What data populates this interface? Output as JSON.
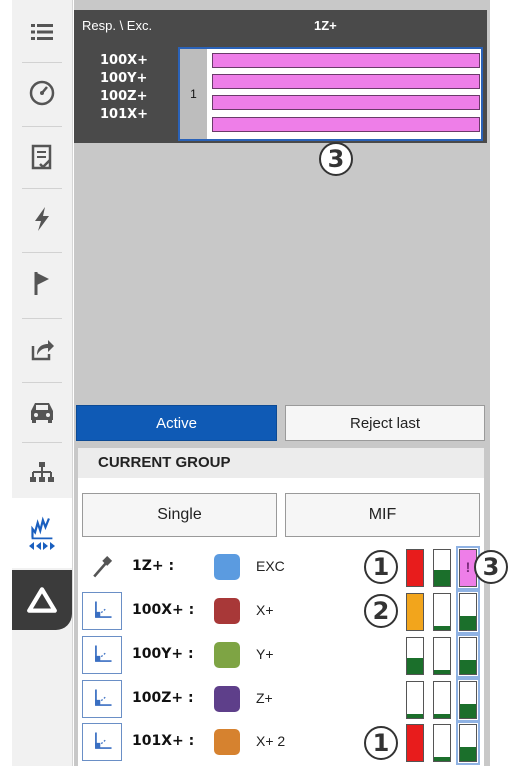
{
  "matrix": {
    "header_resp_exc": "Resp. \\ Exc.",
    "header_excitation": "1Z+",
    "rows": [
      "100X+",
      "100Y+",
      "100Z+",
      "101X+"
    ],
    "group_number": "1"
  },
  "buttons": {
    "active": "Active",
    "reject_last": "Reject last",
    "single": "Single",
    "mif": "MIF"
  },
  "current_group": {
    "title": "CURRENT GROUP"
  },
  "channels": [
    {
      "name": "1Z+ :",
      "color": "#5b9be0",
      "direction": "EXC",
      "icon": "hammer-icon",
      "meters": [
        {
          "level": 1.0,
          "color": "#e81c1c"
        },
        {
          "level": 0.45,
          "color": "#1b6f2b"
        },
        {
          "level": 1.0,
          "color": "#ee7ee8",
          "mark": "!"
        }
      ]
    },
    {
      "name": "100X+ :",
      "color": "#a83838",
      "direction": "X+",
      "icon": "accelerometer-icon",
      "meters": [
        {
          "level": 1.0,
          "color": "#f2a51c"
        },
        {
          "level": 0.1,
          "color": "#1b6f2b"
        },
        {
          "level": 0.4,
          "color": "#1b6f2b"
        }
      ]
    },
    {
      "name": "100Y+ :",
      "color": "#7ea444",
      "direction": "Y+",
      "icon": "accelerometer-icon",
      "meters": [
        {
          "level": 0.45,
          "color": "#1b6f2b"
        },
        {
          "level": 0.1,
          "color": "#1b6f2b"
        },
        {
          "level": 0.4,
          "color": "#1b6f2b"
        }
      ]
    },
    {
      "name": "100Z+ :",
      "color": "#5e3f8a",
      "direction": "Z+",
      "icon": "accelerometer-icon",
      "meters": [
        {
          "level": 0.1,
          "color": "#1b6f2b"
        },
        {
          "level": 0.1,
          "color": "#1b6f2b"
        },
        {
          "level": 0.4,
          "color": "#1b6f2b"
        }
      ]
    },
    {
      "name": "101X+ :",
      "color": "#d6822f",
      "direction": "X+ 2",
      "icon": "accelerometer-icon",
      "meters": [
        {
          "level": 1.0,
          "color": "#e81c1c"
        },
        {
          "level": 0.1,
          "color": "#1b6f2b"
        },
        {
          "level": 0.4,
          "color": "#1b6f2b"
        }
      ]
    }
  ],
  "callouts": {
    "matrix": "3",
    "ch1_left": "1",
    "ch1_right": "3",
    "ch2_left": "2",
    "ch5_left": "1"
  },
  "toolbar": [
    "list-icon",
    "gauge-icon",
    "checklist-icon",
    "lightning-icon",
    "flag-icon",
    "export-icon",
    "car-icon",
    "hierarchy-icon",
    "frf-icon",
    "triangle-logo-icon"
  ],
  "colors": {
    "active_blue": "#0f5ab5",
    "matrix_bg": "#4a4a4a",
    "matrix_bar": "#ee7ee8"
  }
}
